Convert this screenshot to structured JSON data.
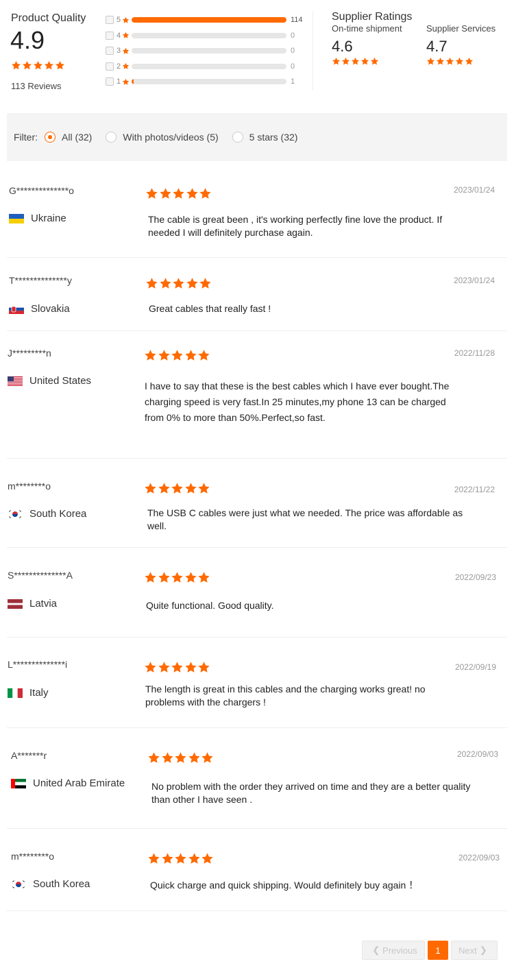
{
  "summary": {
    "quality_title": "Product Quality",
    "quality_score": "4.9",
    "reviews_count": "113 Reviews",
    "distribution": [
      {
        "stars": "5",
        "count": "114",
        "fill": 1.0
      },
      {
        "stars": "4",
        "count": "0",
        "fill": 0
      },
      {
        "stars": "3",
        "count": "0",
        "fill": 0
      },
      {
        "stars": "2",
        "count": "0",
        "fill": 0
      },
      {
        "stars": "1",
        "count": "1",
        "fill": 0.009
      }
    ],
    "supplier_title": "Supplier Ratings",
    "ontime_label": "On-time shipment",
    "ontime_score": "4.6",
    "services_label": "Supplier Services",
    "services_score": "4.7"
  },
  "filter": {
    "label": "Filter:",
    "options": [
      "All (32)",
      "With photos/videos (5)",
      "5 stars (32)"
    ],
    "selected": "All (32)"
  },
  "reviews": [
    {
      "name": "G**************o",
      "country": "Ukraine",
      "flag": "ukraine-flag",
      "date": "2023/01/24",
      "rating": 5,
      "text": "The cable is great been , it's working perfectly fine love the product. If needed I will definitely purchase again."
    },
    {
      "name": "T**************y",
      "country": "Slovakia",
      "flag": "slovakia-flag",
      "date": "2023/01/24",
      "rating": 5,
      "text": "Great cables that really fast !"
    },
    {
      "name": "J*********n",
      "country": "United States",
      "flag": "usa-flag",
      "date": "2022/11/28",
      "rating": 5,
      "text": "I have to say that these is the best cables which I have ever bought.The charging speed is very fast.In 25 minutes,my  phone 13 can be charged from 0% to more than 50%.Perfect,so fast."
    },
    {
      "name": "m********o",
      "country": "South Korea",
      "flag": "south-korea-flag",
      "date": "2022/11/22",
      "rating": 5,
      "text": "The USB C cables were just what we needed. The price was affordable as well."
    },
    {
      "name": "S**************A",
      "country": "Latvia",
      "flag": "latvia-flag",
      "date": "2022/09/23",
      "rating": 5,
      "text": "Quite functional. Good quality."
    },
    {
      "name": "L**************i",
      "country": "Italy",
      "flag": "italy-flag",
      "date": "2022/09/19",
      "rating": 5,
      "text": "The length is great in this cables and the charging works great! no problems with the chargers !"
    },
    {
      "name": "A*******r",
      "country": "United Arab Emirate",
      "flag": "uae-flag",
      "date": "2022/09/03",
      "rating": 5,
      "text": "No problem with the order they arrived on time and they are a better quality than other I have seen ."
    },
    {
      "name": "m********o",
      "country": "South Korea",
      "flag": "south-korea-flag",
      "date": "2022/09/03",
      "rating": 5,
      "text": "Quick charge and quick shipping. Would definitely buy again ！"
    }
  ],
  "pagination": {
    "prev_label": "Previous",
    "current_page": "1",
    "next_label": "Next"
  },
  "colors": {
    "accent": "#ff6a00",
    "filter_bg": "#f4f4f4",
    "track": "#e6e6e6"
  }
}
